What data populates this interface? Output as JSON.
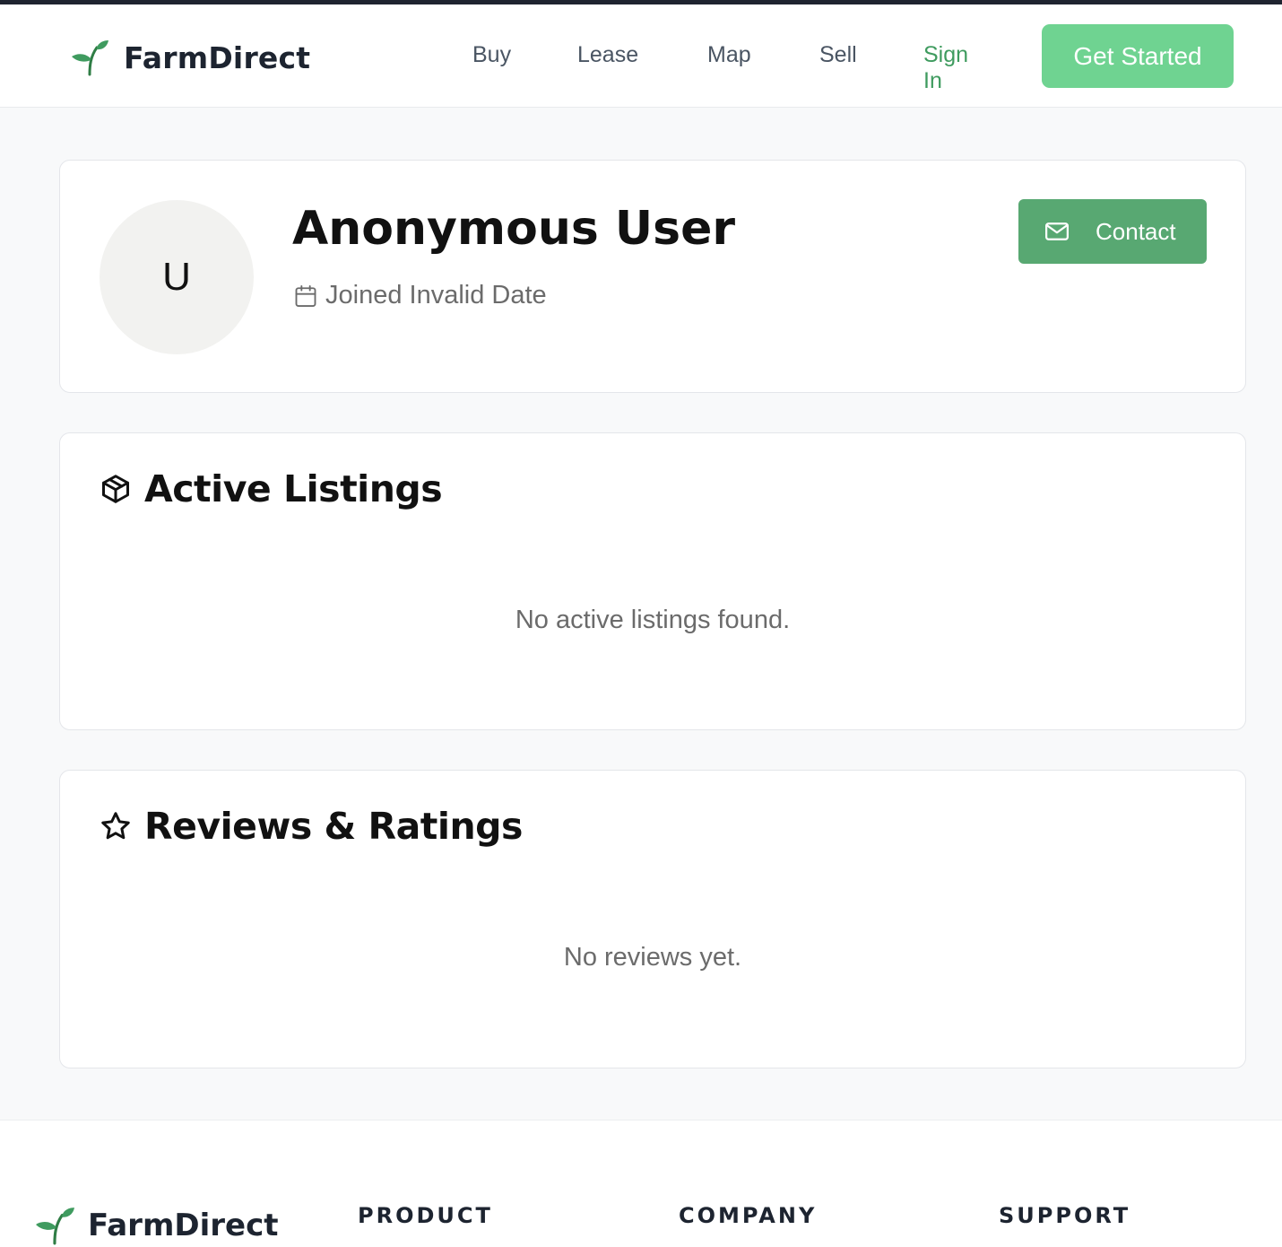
{
  "brand": {
    "name": "FarmDirect",
    "logo_icon": "sprout-icon",
    "accent_color": "#3f9b5f"
  },
  "nav": {
    "links": [
      "Buy",
      "Lease",
      "Map",
      "Sell"
    ],
    "sign_in": "Sign In",
    "get_started": "Get Started"
  },
  "profile": {
    "avatar_initial": "U",
    "name": "Anonymous User",
    "joined_icon": "calendar-icon",
    "joined_text": "Joined Invalid Date",
    "contact_icon": "mail-icon",
    "contact_label": "Contact",
    "contact_color": "#58a872"
  },
  "listings": {
    "icon": "package-icon",
    "title": "Active Listings",
    "empty_text": "No active listings found."
  },
  "reviews": {
    "icon": "star-icon",
    "title": "Reviews & Ratings",
    "empty_text": "No reviews yet."
  },
  "footer": {
    "brand_name": "FarmDirect",
    "headings": [
      "PRODUCT",
      "COMPANY",
      "SUPPORT"
    ]
  }
}
